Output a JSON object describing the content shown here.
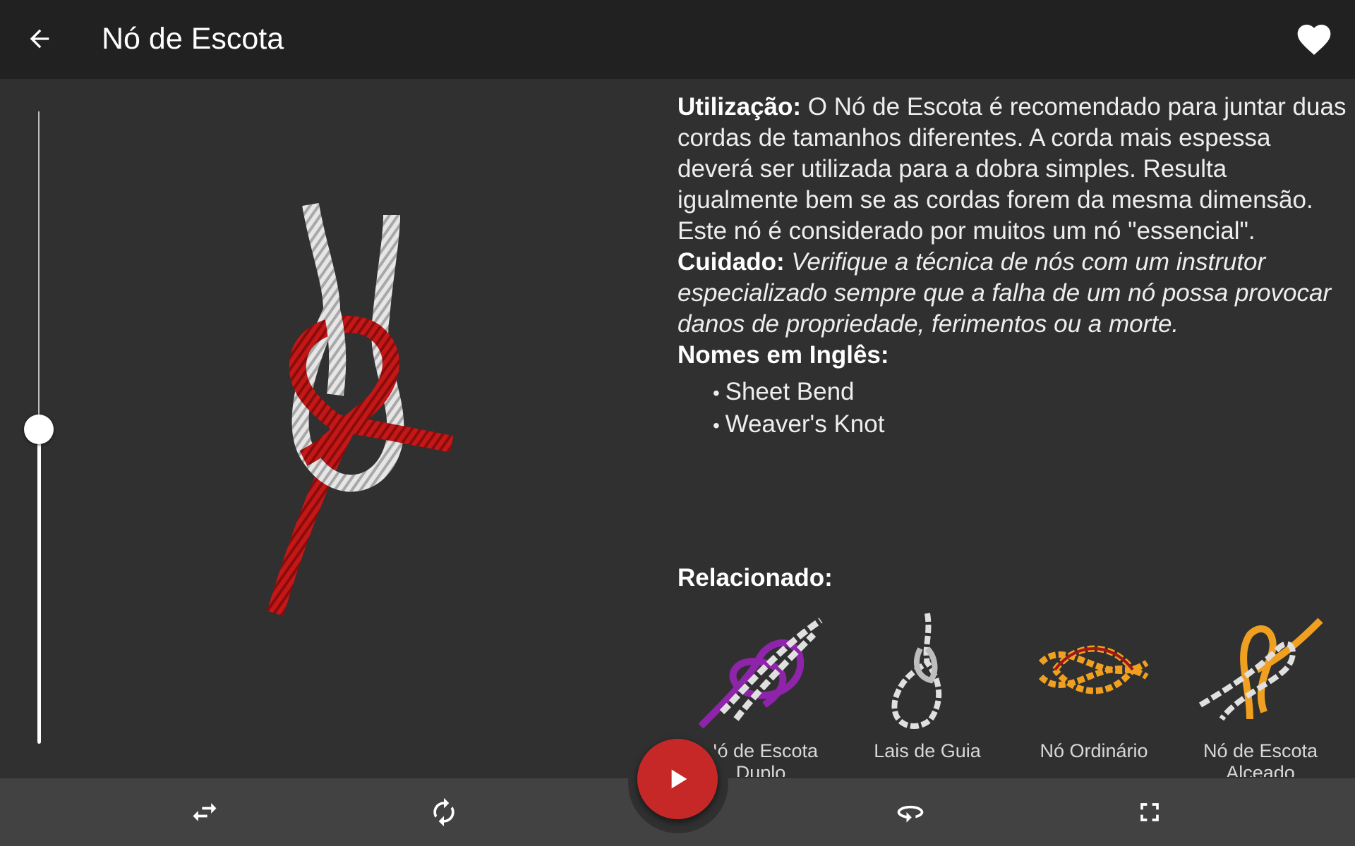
{
  "appbar": {
    "title": "Nó de Escota",
    "back_icon": "arrow-back-icon",
    "favorite_icon": "heart-icon"
  },
  "speed_slider": {
    "value_fraction": 0.5
  },
  "description": {
    "usage_label": "Utilização:",
    "usage_text": " O Nó de Escota é recomendado para juntar duas cordas de tamanhos diferentes. A corda mais espessa deverá ser utilizada para a dobra simples. Resulta igualmente bem se as cordas forem da mesma dimensão. Este nó é considerado por muitos um nó \"essencial\".",
    "warning_label": "Cuidado:",
    "warning_text": " Verifique a técnica de nós com um instrutor especializado sempre que a falha de um nó possa provocar danos de propriedade, ferimentos ou a morte.",
    "english_names_label": "Nomes em Inglês:",
    "english_names": [
      "Sheet Bend",
      "Weaver's Knot"
    ],
    "related_label": "Relacionado:"
  },
  "related": [
    {
      "label": "Nó de Escota Duplo",
      "color": "#8e24aa"
    },
    {
      "label": "Lais de Guia",
      "color": "#e0e0e0"
    },
    {
      "label": "Nó Ordinário",
      "color": "#f0a020"
    },
    {
      "label": "Nó de Escota Alceado",
      "color": "#f0a020"
    }
  ],
  "colors": {
    "appbar": "#212121",
    "background": "#303030",
    "bottom_bar": "#424242",
    "accent": "#c62828",
    "rope_red": "#b71c1c",
    "rope_white": "#e0e0e0"
  },
  "bottom_bar": {
    "icons": [
      "swap-horiz-icon",
      "autorenew-icon",
      "play-icon",
      "rotate-360-icon",
      "fullscreen-icon"
    ]
  }
}
